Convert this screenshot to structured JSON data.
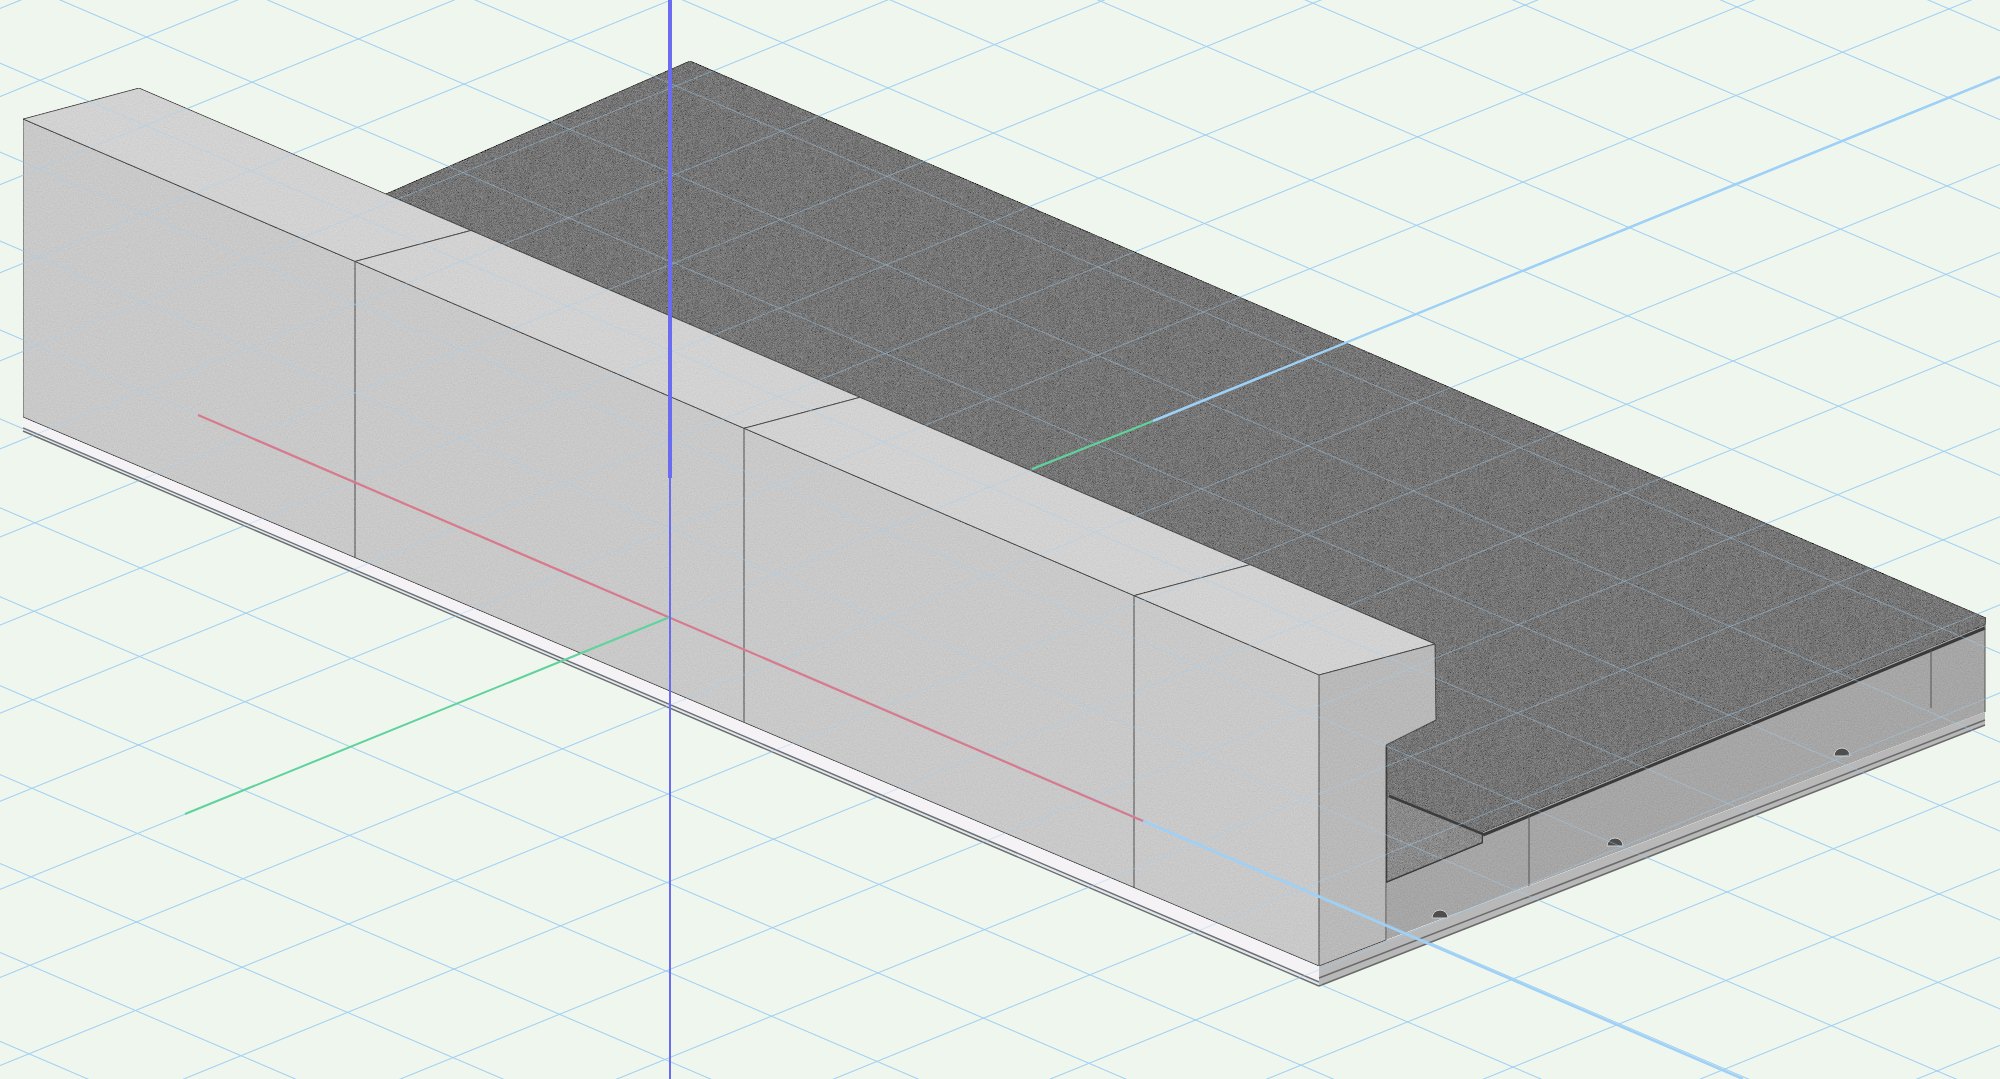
{
  "viewport": {
    "axes": [
      {
        "kind": "x",
        "color": "#d8798c"
      },
      {
        "kind": "y",
        "color": "#5fd39c"
      },
      {
        "kind": "z",
        "color": "#6b6bf2"
      }
    ]
  }
}
